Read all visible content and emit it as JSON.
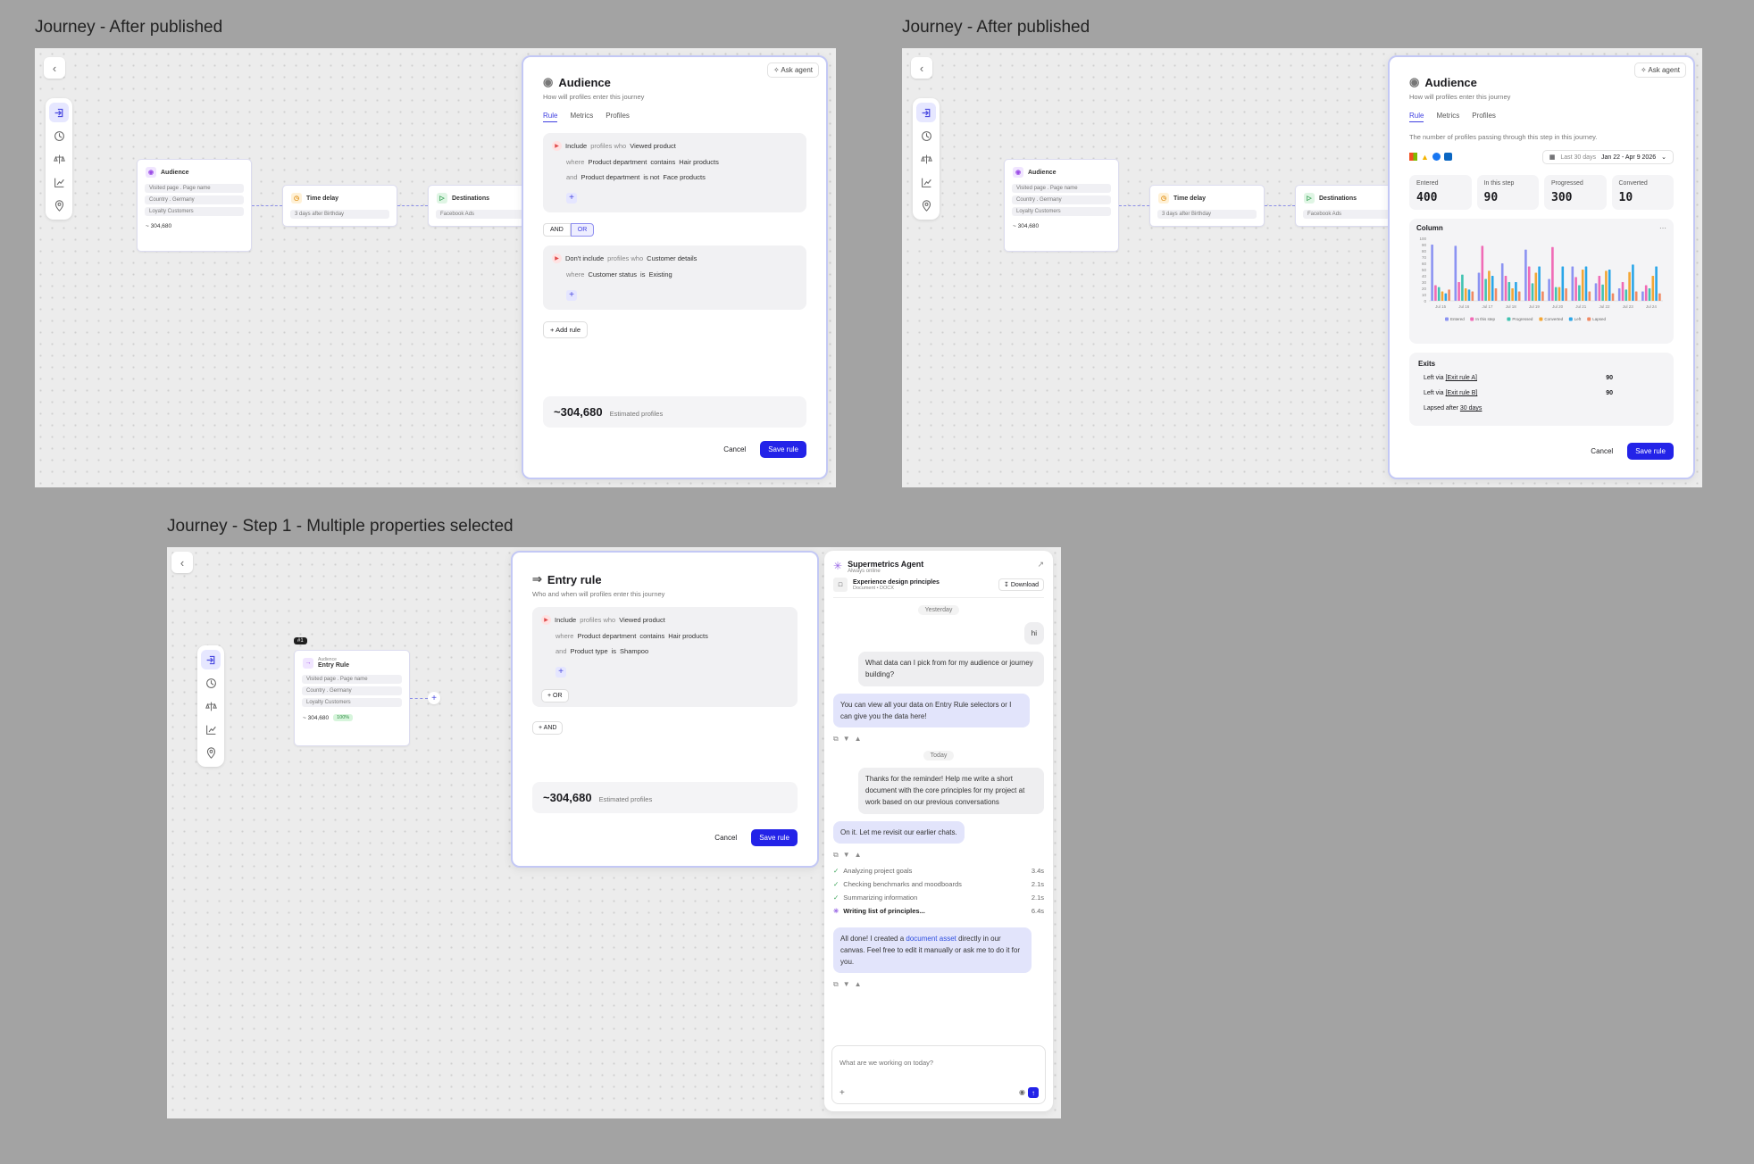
{
  "frames": {
    "f1_title": "Journey - After published",
    "f2_title": "Journey - After published",
    "f3_title": "Journey - Step 1 - Multiple properties selected"
  },
  "colors": {
    "accent": "#2323e8",
    "canvas": "#ececec",
    "page": "#a3a3a3"
  },
  "icons": [
    "chevron-left-icon",
    "entry-icon",
    "clock-icon",
    "scale-icon",
    "chart-icon",
    "pin-icon",
    "audience-icon",
    "sparkle-icon",
    "play-icon",
    "check-icon",
    "download-icon",
    "calendar-icon"
  ],
  "nodes": {
    "audience": {
      "title": "Audience",
      "items": [
        "Visited page . Page name",
        "Country . Germany",
        "Loyalty Customers"
      ],
      "count": "~ 304,680"
    },
    "time_delay": {
      "title": "Time delay",
      "item": "3 days after Birthday"
    },
    "destinations": {
      "title": "Destinations",
      "item": "Facebook Ads"
    },
    "entry": {
      "tag": "#1",
      "kicker": "Audience",
      "title": "Entry Rule",
      "items": [
        "Visited page . Page name",
        "Country . Germany",
        "Loyalty Customers"
      ],
      "count": "~ 304,680",
      "pct": "100%"
    }
  },
  "panel1": {
    "ask_agent": "Ask agent",
    "title": "Audience",
    "subtitle": "How will profiles enter this journey",
    "tabs": [
      "Rule",
      "Metrics",
      "Profiles"
    ],
    "rule1": {
      "include": "Include",
      "profiles_who": "profiles who",
      "event": "Viewed product",
      "w_where": "where",
      "w_prop": "Product department",
      "w_op": "contains",
      "w_val": "Hair products",
      "a_and": "and",
      "a_prop": "Product department",
      "a_op": "is not",
      "a_val": "Face products"
    },
    "and": "AND",
    "or": "OR",
    "rule2": {
      "dont": "Don't include",
      "profiles_who": "profiles who",
      "event": "Customer details",
      "w_where": "where",
      "w_prop": "Customer status",
      "w_op": "is",
      "w_val": "Existing"
    },
    "add_rule": "Add rule",
    "estimate": "~304,680",
    "estimate_label": "Estimated profiles",
    "cancel": "Cancel",
    "save": "Save rule"
  },
  "panel2": {
    "ask_agent": "Ask agent",
    "title": "Audience",
    "subtitle": "How will profiles enter this journey",
    "tabs": [
      "Rule",
      "Metrics",
      "Profiles"
    ],
    "desc": "The number of profiles passing through this step in this journey.",
    "date_range": "Last 30 days",
    "date_span": "Jan 22 - Apr 9 2026",
    "stats": [
      {
        "label": "Entered",
        "value": "400"
      },
      {
        "label": "In this step",
        "value": "90"
      },
      {
        "label": "Progressed",
        "value": "300"
      },
      {
        "label": "Converted",
        "value": "10"
      }
    ],
    "exits_title": "Exits",
    "exits": [
      {
        "pre": "Left via",
        "link": "[Exit rule A]",
        "value": "90"
      },
      {
        "pre": "Left via",
        "link": "[Exit rule B]",
        "value": "90"
      },
      {
        "pre": "Lapsed after",
        "link": "30 days",
        "value": ""
      }
    ],
    "cancel": "Cancel",
    "save": "Save rule"
  },
  "chart_data": {
    "type": "bar",
    "title": "Column",
    "categories": [
      "Jul 15",
      "Jul 16",
      "Jul 17",
      "Jul 18",
      "Jul 19",
      "Jul 20",
      "Jul 21",
      "Jul 22",
      "Jul 23",
      "Jul 24"
    ],
    "ylim": [
      0,
      100
    ],
    "yticks": [
      "100",
      "90",
      "80",
      "70",
      "60",
      "50",
      "40",
      "30",
      "20",
      "10",
      "0"
    ],
    "legend_position": "bottom",
    "series": [
      {
        "name": "Entered",
        "color": "#8b93f2",
        "values": [
          90,
          88,
          45,
          60,
          82,
          35,
          55,
          28,
          20,
          15
        ]
      },
      {
        "name": "In this step",
        "color": "#f06bb6",
        "values": [
          25,
          30,
          88,
          40,
          55,
          86,
          38,
          40,
          30,
          25
        ]
      },
      {
        "name": "Progressed",
        "color": "#41c3b1",
        "values": [
          22,
          42,
          35,
          30,
          28,
          22,
          25,
          26,
          18,
          20
        ]
      },
      {
        "name": "Converted",
        "color": "#f3a634",
        "values": [
          15,
          20,
          48,
          20,
          45,
          22,
          50,
          48,
          46,
          40
        ]
      },
      {
        "name": "Left",
        "color": "#2aa6e8",
        "values": [
          12,
          18,
          40,
          30,
          55,
          55,
          55,
          50,
          58,
          55
        ]
      },
      {
        "name": "Lapsed",
        "color": "#f08a64",
        "values": [
          18,
          15,
          20,
          15,
          15,
          20,
          15,
          12,
          15,
          12
        ]
      }
    ]
  },
  "panel3": {
    "title": "Entry rule",
    "subtitle": "Who and when will profiles enter this journey",
    "rule": {
      "include": "Include",
      "profiles_who": "profiles who",
      "event": "Viewed product",
      "w_where": "where",
      "w_prop": "Product department",
      "w_op": "contains",
      "w_val": "Hair products",
      "a_and": "and",
      "a_prop": "Product type",
      "a_op": "is",
      "a_val": "Shampoo"
    },
    "or_btn": "OR",
    "and_btn": "AND",
    "estimate": "~304,680",
    "estimate_label": "Estimated profiles",
    "cancel": "Cancel",
    "save": "Save rule"
  },
  "agent": {
    "name": "Supermetrics Agent",
    "status": "Always online",
    "doc_title": "Experience design principles",
    "doc_meta": "Document • DOCX",
    "download": "Download",
    "day1": "Yesterday",
    "m_user1": "hi",
    "m_user2": "What data can I pick from for my audience or journey building?",
    "m_bot1": "You can view all your data on Entry Rule selectors or I can give you the data here!",
    "day2": "Today",
    "m_user3": "Thanks for the reminder! Help me write a short document with the core principles for my project at work based on our previous conversations",
    "m_bot2": "On it. Let me revisit our earlier chats.",
    "steps": [
      {
        "label": "Analyzing project goals",
        "time": "3.4s"
      },
      {
        "label": "Checking benchmarks and moodboards",
        "time": "2.1s"
      },
      {
        "label": "Summarizing information",
        "time": "2.1s"
      }
    ],
    "writing": "Writing list of principles...",
    "writing_time": "6.4s",
    "final_pre": "All done! I created a",
    "final_link": "document asset",
    "final_post": "directly in our canvas. Feel free to edit it manually or ask me to do it for you.",
    "input_placeholder": "What are we working on today?"
  }
}
